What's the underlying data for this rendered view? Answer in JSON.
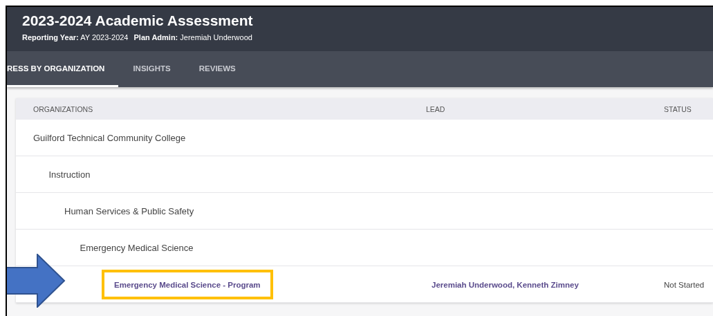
{
  "header": {
    "title": "2023-2024 Academic Assessment",
    "reporting_year_label": "Reporting Year:",
    "reporting_year": "AY 2023-2024",
    "plan_admin_label": "Plan Admin:",
    "plan_admin": "Jeremiah Underwood"
  },
  "tabs": [
    {
      "label": "RESS BY ORGANIZATION",
      "selected": true
    },
    {
      "label": "INSIGHTS",
      "selected": false
    },
    {
      "label": "REVIEWS",
      "selected": false
    }
  ],
  "table": {
    "columns": [
      "ORGANIZATIONS",
      "LEAD",
      "STATUS"
    ],
    "rows": [
      {
        "name": "Guilford Technical Community College",
        "kind": "group",
        "children": [
          {
            "name": "Instruction",
            "kind": "group",
            "children": [
              {
                "name": "Human Services & Public Safety",
                "kind": "group",
                "children": [
                  {
                    "name": "Emergency Medical Science",
                    "kind": "group",
                    "children": [
                      {
                        "name": "Emergency Medical Science - Program",
                        "kind": "link",
                        "lead": "Jeremiah Underwood, Kenneth Zimney",
                        "status": "Not Started",
                        "highlighted": true
                      }
                    ]
                  }
                ]
              }
            ]
          }
        ]
      }
    ]
  }
}
